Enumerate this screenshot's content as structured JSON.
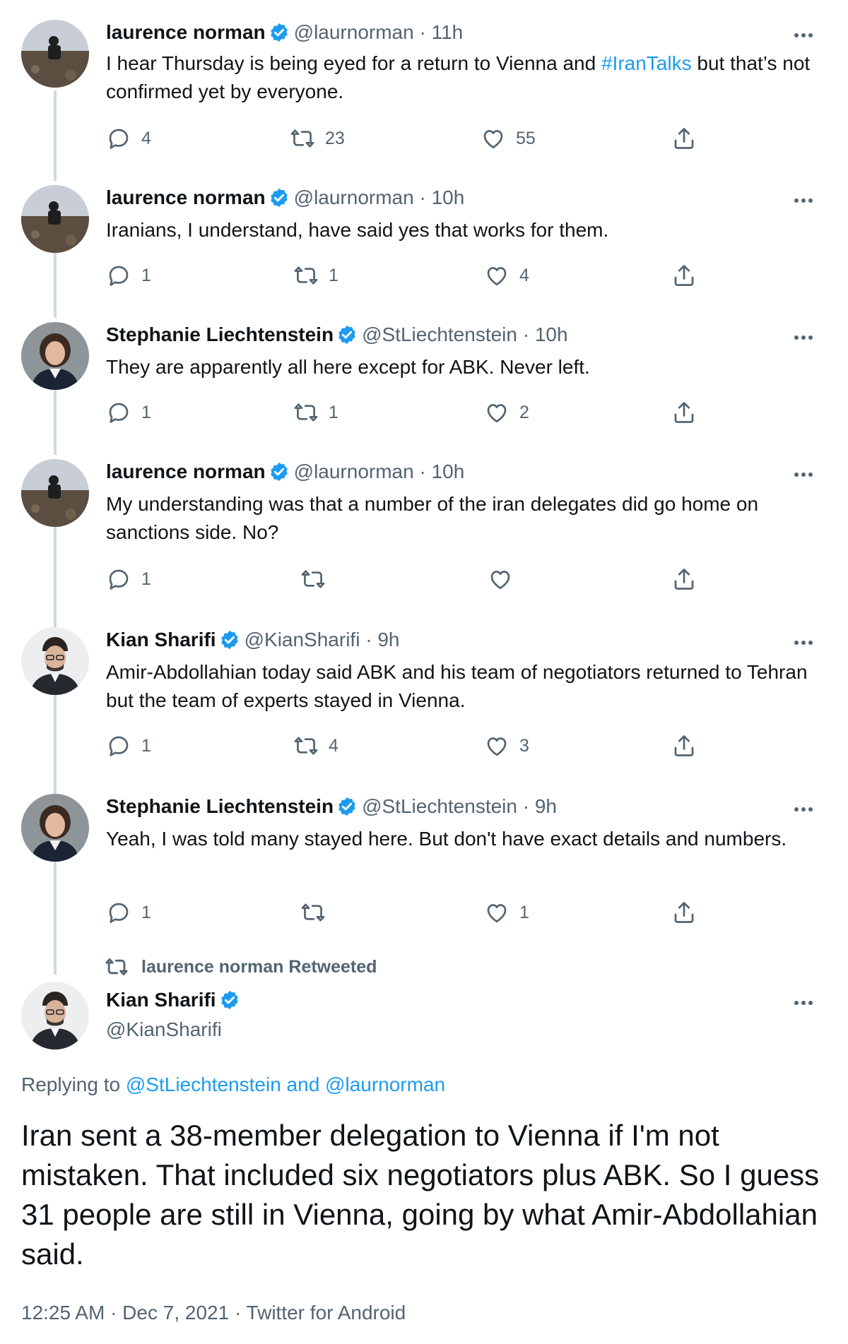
{
  "tweets": [
    {
      "name": "laurence norman",
      "handle": "@laurnorman",
      "sep": "·",
      "time": "11h",
      "text_before": "I hear Thursday is being eyed for a return to Vienna and ",
      "hashtag": "#IranTalks",
      "text_after": " but that’s not confirmed yet by everyone.",
      "reply": "4",
      "retweet": "23",
      "like": "55",
      "avatar": "landscape-person"
    },
    {
      "name": "laurence norman",
      "handle": "@laurnorman",
      "sep": "·",
      "time": "10h",
      "text": "Iranians, I understand, have said yes that works for them.",
      "reply": "1",
      "retweet": "1",
      "like": "4",
      "avatar": "landscape-person"
    },
    {
      "name": "Stephanie Liechtenstein",
      "handle": "@StLiechtenstein",
      "sep": "·",
      "time": "10h",
      "text": "They are apparently all here except for ABK. Never left.",
      "reply": "1",
      "retweet": "1",
      "like": "2",
      "avatar": "woman-portrait"
    },
    {
      "name": "laurence norman",
      "handle": "@laurnorman",
      "sep": "·",
      "time": "10h",
      "text": "My understanding was that a number of the iran delegates did go home on sanctions side. No?",
      "reply": "1",
      "retweet": "",
      "like": "",
      "avatar": "landscape-person"
    },
    {
      "name": "Kian Sharifi",
      "handle": "@KianSharifi",
      "sep": "·",
      "time": "9h",
      "text": "Amir-Abdollahian today said ABK and his team of negotiators returned to Tehran but the team of experts stayed in Vienna.",
      "reply": "1",
      "retweet": "4",
      "like": "3",
      "avatar": "man-portrait"
    },
    {
      "name": "Stephanie Liechtenstein",
      "handle": "@StLiechtenstein",
      "sep": "·",
      "time": "9h",
      "text": "Yeah, I was told many stayed here. But don't have exact details and numbers.",
      "reply": "1",
      "retweet": "",
      "like": "1",
      "avatar": "woman-portrait"
    }
  ],
  "retweeted_label": "laurence norman Retweeted",
  "main_tweet": {
    "name": "Kian Sharifi",
    "handle": "@KianSharifi",
    "replying_prefix": "Replying to ",
    "replying_user1": "@StLiechtenstein",
    "replying_and": " and ",
    "replying_user2": "@laurnorman",
    "text": "Iran sent a 38-member delegation to Vienna if I'm not mistaken. That included six negotiators plus ABK. So I guess 31 people are still in Vienna, going by what Amir-Abdollahian said.",
    "timestamp": "12:25 AM · Dec 7, 2021 · Twitter for Android"
  },
  "colors": {
    "accent": "#1d9bf0",
    "muted": "#536471",
    "text": "#0f1419",
    "thread_line": "#cfd9de"
  }
}
